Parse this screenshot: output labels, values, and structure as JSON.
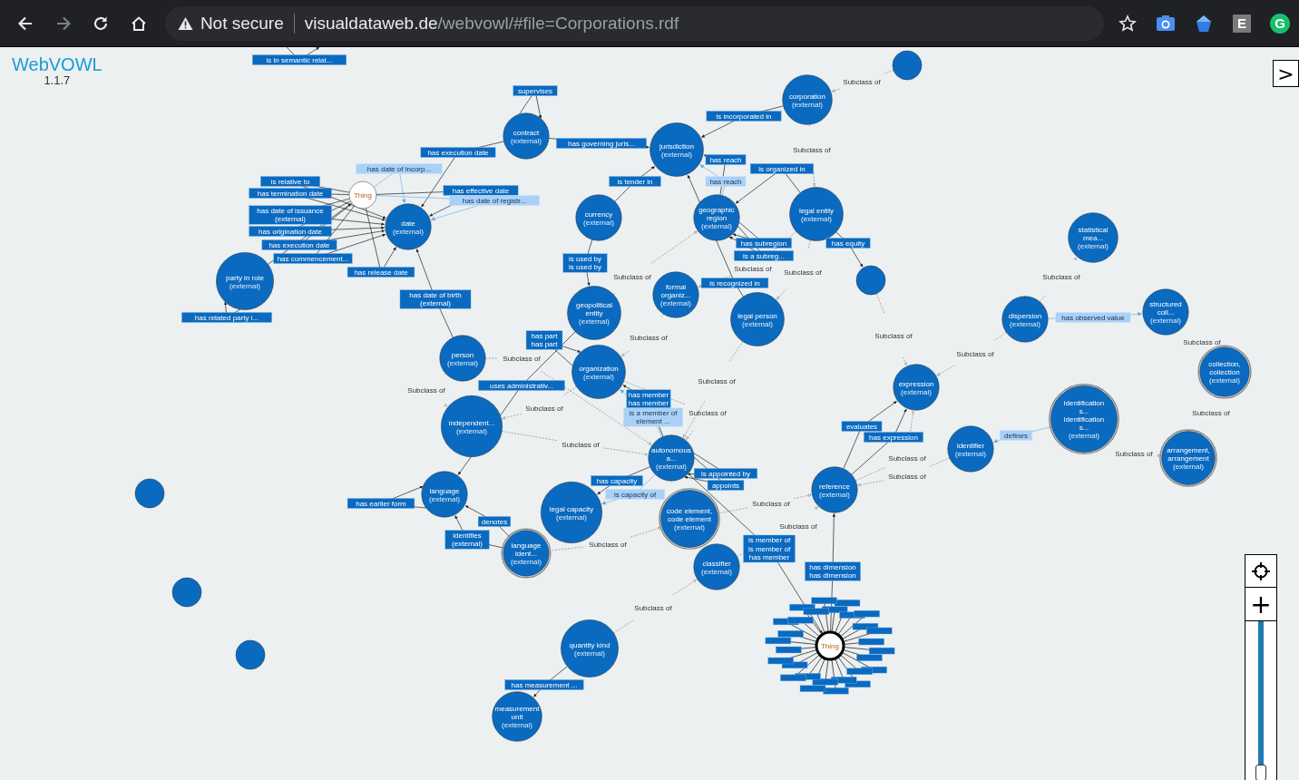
{
  "browser": {
    "nav_buttons": [
      {
        "kind": "back",
        "disabled": false
      },
      {
        "kind": "forward",
        "disabled": true
      },
      {
        "kind": "reload",
        "disabled": false
      },
      {
        "kind": "home",
        "disabled": false
      }
    ],
    "security_label": "Not secure",
    "url_host": "visualdataweb.de",
    "url_path": "/webvowl/#file=Corporations.rdf",
    "extensions": [
      {
        "kind": "star"
      },
      {
        "kind": "camera"
      },
      {
        "kind": "shield"
      },
      {
        "kind": "letter",
        "text": "E"
      },
      {
        "kind": "round-letter",
        "text": "G"
      }
    ]
  },
  "app": {
    "title": "WebVOWL",
    "version": "1.1.7",
    "sidebar_toggle": ">",
    "zoom": {
      "level": 0.0,
      "zoom_in": "+"
    }
  },
  "graph": {
    "nodes": [
      {
        "kind": "class",
        "lines": [
          "contract"
        ],
        "sublabel": "(external)",
        "equivalent": false
      },
      {
        "kind": "class",
        "lines": [
          "jurisdiction"
        ],
        "sublabel": "(external)",
        "equivalent": false
      },
      {
        "kind": "class",
        "lines": [
          "corporation"
        ],
        "sublabel": "(external)",
        "equivalent": false
      },
      {
        "kind": "class",
        "lines": [
          "date"
        ],
        "sublabel": "(external)",
        "equivalent": false
      },
      {
        "kind": "class",
        "lines": [
          "currency"
        ],
        "sublabel": "(external)",
        "equivalent": false
      },
      {
        "kind": "class",
        "lines": [
          "geographic",
          "region"
        ],
        "sublabel": "(external)",
        "equivalent": false
      },
      {
        "kind": "class",
        "lines": [
          "legal entity"
        ],
        "sublabel": "(external)",
        "equivalent": false
      },
      {
        "kind": "class",
        "lines": [
          "party in role"
        ],
        "sublabel": "(external)",
        "equivalent": false
      },
      {
        "kind": "class",
        "lines": [
          "geopolitical",
          "entity"
        ],
        "sublabel": "(external)",
        "equivalent": false
      },
      {
        "kind": "class",
        "lines": [
          "formal",
          "organiz..."
        ],
        "sublabel": "(external)",
        "equivalent": false
      },
      {
        "kind": "class",
        "lines": [
          "legal person"
        ],
        "sublabel": "(external)",
        "equivalent": false
      },
      {
        "kind": "class",
        "equivalent": false
      },
      {
        "kind": "class",
        "lines": [
          "statistical",
          "mea..."
        ],
        "sublabel": "(external)",
        "equivalent": false
      },
      {
        "kind": "class",
        "lines": [
          "dispersion"
        ],
        "sublabel": "(external)",
        "equivalent": false
      },
      {
        "kind": "class",
        "lines": [
          "structured",
          "coll..."
        ],
        "sublabel": "(external)",
        "equivalent": false
      },
      {
        "kind": "class",
        "lines": [
          "collection,",
          "collection"
        ],
        "sublabel": "(external)",
        "equivalent": true
      },
      {
        "kind": "class",
        "lines": [
          "expression"
        ],
        "sublabel": "(external)",
        "equivalent": false
      },
      {
        "kind": "class",
        "lines": [
          "identifier"
        ],
        "sublabel": "(external)",
        "equivalent": false
      },
      {
        "kind": "class",
        "lines": [
          "identification",
          "s...",
          "identification",
          "s..."
        ],
        "sublabel": "(external)",
        "equivalent": true
      },
      {
        "kind": "class",
        "lines": [
          "arrangement,",
          "arrangement"
        ],
        "sublabel": "(external)",
        "equivalent": true
      },
      {
        "kind": "class",
        "lines": [
          "reference"
        ],
        "sublabel": "(external)",
        "equivalent": false
      },
      {
        "kind": "class",
        "lines": [
          "person"
        ],
        "sublabel": "(external)",
        "equivalent": false
      },
      {
        "kind": "class",
        "lines": [
          "organization"
        ],
        "sublabel": "(external)",
        "equivalent": false
      },
      {
        "kind": "class",
        "lines": [
          "independent..."
        ],
        "sublabel": "(external)",
        "equivalent": false
      },
      {
        "kind": "class",
        "lines": [
          "autonomous",
          "a..."
        ],
        "sublabel": "(external)",
        "equivalent": false
      },
      {
        "kind": "class",
        "lines": [
          "language"
        ],
        "sublabel": "(external)",
        "equivalent": false
      },
      {
        "kind": "class",
        "lines": [
          "legal capacity"
        ],
        "sublabel": "(external)",
        "equivalent": false
      },
      {
        "kind": "class",
        "lines": [
          "code element,",
          "code element"
        ],
        "sublabel": "(external)",
        "equivalent": true
      },
      {
        "kind": "class",
        "lines": [
          "language",
          "ident..."
        ],
        "sublabel": "(external)",
        "equivalent": true
      },
      {
        "kind": "class",
        "lines": [
          "classifier"
        ],
        "sublabel": "(external)",
        "equivalent": false
      },
      {
        "kind": "class",
        "lines": [
          "quantity kind"
        ],
        "sublabel": "(external)",
        "equivalent": false
      },
      {
        "kind": "class",
        "lines": [
          "measurement",
          "unit"
        ],
        "sublabel": "(external)",
        "equivalent": false
      },
      {
        "kind": "class",
        "equivalent": false
      },
      {
        "kind": "class",
        "equivalent": false
      },
      {
        "kind": "class",
        "equivalent": false
      },
      {
        "kind": "thing",
        "lines": [
          "Thing"
        ],
        "equivalent": false
      },
      {
        "kind": "thing",
        "lines": [
          "Thing"
        ],
        "equivalent": false
      },
      {
        "kind": "class",
        "equivalent": false
      }
    ],
    "properties": [
      {
        "kind": "object",
        "lines": [
          "is in semantic relat..."
        ]
      },
      {
        "kind": "subclass",
        "lines": [
          "Subclass of"
        ]
      },
      {
        "kind": "object",
        "lines": [
          "supervises"
        ]
      },
      {
        "kind": "object",
        "lines": [
          "is incorporated in"
        ]
      },
      {
        "kind": "object",
        "lines": [
          "has governing juris..."
        ]
      },
      {
        "kind": "object",
        "lines": [
          "has execution date"
        ]
      },
      {
        "kind": "subclass",
        "lines": [
          "Subclass of"
        ]
      },
      {
        "kind": "object",
        "lines": [
          "has reach"
        ]
      },
      {
        "kind": "light",
        "lines": [
          "has date of incorp..."
        ]
      },
      {
        "kind": "object",
        "lines": [
          "is organized in"
        ]
      },
      {
        "kind": "object",
        "lines": [
          "is relative to"
        ]
      },
      {
        "kind": "object",
        "lines": [
          "is tender in"
        ]
      },
      {
        "kind": "light",
        "lines": [
          "has reach"
        ]
      },
      {
        "kind": "object",
        "lines": [
          "has termination date"
        ]
      },
      {
        "kind": "object",
        "lines": [
          "has effective date"
        ]
      },
      {
        "kind": "light",
        "lines": [
          "has date of registr..."
        ]
      },
      {
        "kind": "object",
        "lines": [
          "has date of issuance",
          "(external)"
        ]
      },
      {
        "kind": "object",
        "lines": [
          "has origination date"
        ]
      },
      {
        "kind": "object",
        "lines": [
          "has execution date"
        ]
      },
      {
        "kind": "object",
        "lines": [
          "has subregion"
        ]
      },
      {
        "kind": "object",
        "lines": [
          "has equity"
        ]
      },
      {
        "kind": "object",
        "lines": [
          "has commencement..."
        ]
      },
      {
        "kind": "object",
        "lines": [
          "is used by",
          "is used by"
        ]
      },
      {
        "kind": "object",
        "lines": [
          "is a subreg..."
        ]
      },
      {
        "kind": "subclass",
        "lines": [
          "Subclass of"
        ]
      },
      {
        "kind": "object",
        "lines": [
          "has release date"
        ]
      },
      {
        "kind": "object",
        "lines": [
          "is recognized in"
        ]
      },
      {
        "kind": "subclass",
        "lines": [
          "Subclass of"
        ]
      },
      {
        "kind": "subclass",
        "lines": [
          "Subclass of"
        ]
      },
      {
        "kind": "subclass",
        "lines": [
          "Subclass of"
        ]
      },
      {
        "kind": "object",
        "lines": [
          "has date of birth",
          "(external)"
        ]
      },
      {
        "kind": "object",
        "lines": [
          "has related party i..."
        ]
      },
      {
        "kind": "light",
        "lines": [
          "has observed value"
        ]
      },
      {
        "kind": "object",
        "lines": [
          "has part",
          "has part"
        ]
      },
      {
        "kind": "subclass",
        "lines": [
          "Subclass of"
        ]
      },
      {
        "kind": "subclass",
        "lines": [
          "Subclass of"
        ]
      },
      {
        "kind": "subclass",
        "lines": [
          "Subclass of"
        ]
      },
      {
        "kind": "subclass",
        "lines": [
          "Subclass of"
        ]
      },
      {
        "kind": "subclass",
        "lines": [
          "Subclass of"
        ]
      },
      {
        "kind": "object",
        "lines": [
          "uses administrativ..."
        ]
      },
      {
        "kind": "subclass",
        "lines": [
          "Subclass of"
        ]
      },
      {
        "kind": "subclass",
        "lines": [
          "Subclass of"
        ]
      },
      {
        "kind": "object",
        "lines": [
          "has member",
          "has member"
        ]
      },
      {
        "kind": "subclass",
        "lines": [
          "Subclass of"
        ]
      },
      {
        "kind": "light",
        "lines": [
          "is a member of",
          "element ..."
        ]
      },
      {
        "kind": "subclass",
        "lines": [
          "Subclass of"
        ]
      },
      {
        "kind": "subclass",
        "lines": [
          "Subclass of"
        ]
      },
      {
        "kind": "object",
        "lines": [
          "evaluates"
        ]
      },
      {
        "kind": "object",
        "lines": [
          "has expression"
        ]
      },
      {
        "kind": "light",
        "lines": [
          "defines"
        ]
      },
      {
        "kind": "subclass",
        "lines": [
          "Subclass of"
        ]
      },
      {
        "kind": "subclass",
        "lines": [
          "Subclass of"
        ]
      },
      {
        "kind": "subclass",
        "lines": [
          "Subclass of"
        ]
      },
      {
        "kind": "object",
        "lines": [
          "has capacity"
        ]
      },
      {
        "kind": "object",
        "lines": [
          "is appointed by"
        ]
      },
      {
        "kind": "subclass",
        "lines": [
          "Subclass of"
        ]
      },
      {
        "kind": "object",
        "lines": [
          "appoints"
        ]
      },
      {
        "kind": "light",
        "lines": [
          "is capacity of"
        ]
      },
      {
        "kind": "object",
        "lines": [
          "has earlier form"
        ]
      },
      {
        "kind": "subclass",
        "lines": [
          "Subclass of"
        ]
      },
      {
        "kind": "object",
        "lines": [
          "denotes"
        ]
      },
      {
        "kind": "subclass",
        "lines": [
          "Subclass of"
        ]
      },
      {
        "kind": "object",
        "lines": [
          "identifies",
          "(external)"
        ]
      },
      {
        "kind": "subclass",
        "lines": [
          "Subclass of"
        ]
      },
      {
        "kind": "object",
        "lines": [
          "is member of",
          "is member of",
          "has member"
        ]
      },
      {
        "kind": "object",
        "lines": [
          "has dimension",
          "has dimension"
        ]
      },
      {
        "kind": "subclass",
        "lines": [
          "Subclass of"
        ]
      },
      {
        "kind": "object",
        "lines": [
          "has measurement ..."
        ]
      }
    ]
  }
}
